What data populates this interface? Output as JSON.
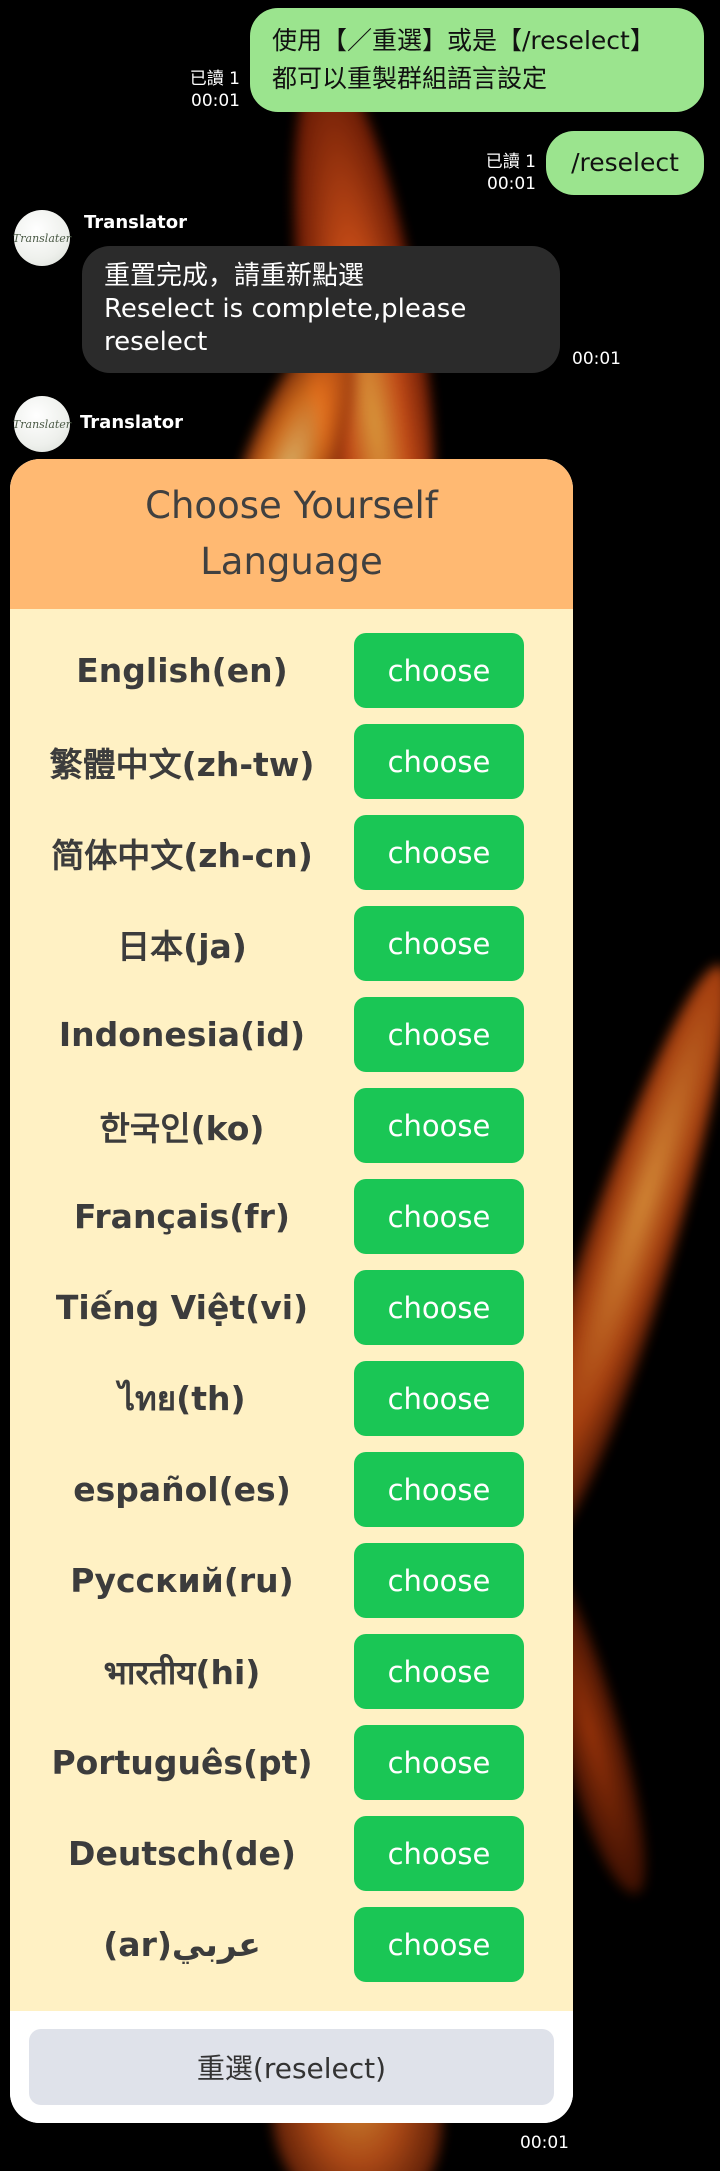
{
  "chat": {
    "messages": [
      {
        "read": "已讀 1",
        "time": "00:01",
        "lines": [
          "使用【／重選】或是【/reselect】",
          "都可以重製群組語言設定"
        ]
      },
      {
        "read": "已讀 1",
        "time": "00:01",
        "text": "/reselect"
      }
    ],
    "bot_name": "Translator",
    "avatar_text": "Translater",
    "reply": {
      "lines": [
        "重置完成，請重新點選",
        "Reselect is complete,please",
        "reselect"
      ],
      "time": "00:01"
    },
    "card_time": "00:01"
  },
  "card": {
    "title": "Choose Yourself Language",
    "button_label": "choose",
    "languages": [
      "English(en)",
      "繁體中文(zh-tw)",
      "简体中文(zh-cn)",
      "日本(ja)",
      "Indonesia(id)",
      "한국인(ko)",
      "Français(fr)",
      "Tiếng Việt(vi)",
      "ไทย(th)",
      "español(es)",
      "Русский(ru)",
      "भारतीय(hi)",
      "Português(pt)",
      "Deutsch(de)",
      "عربي(ar)"
    ],
    "reselect_label": "重選(reselect)"
  },
  "colors": {
    "outgoing_bubble": "#9be48e",
    "incoming_bubble": "#2b2b2b",
    "card_header": "#ffb972",
    "card_body": "#fff1c4",
    "choose_button": "#1ac655",
    "reselect_button": "#dfe2ea"
  }
}
